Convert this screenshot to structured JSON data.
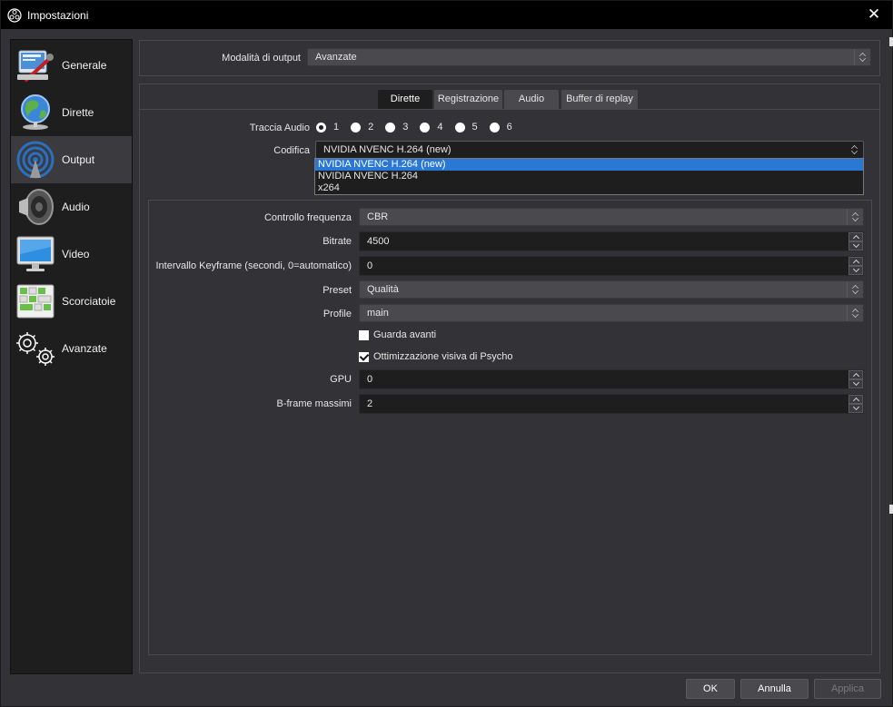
{
  "window": {
    "title": "Impostazioni",
    "close_glyph": "✕"
  },
  "sidebar": {
    "items": [
      {
        "label": "Generale",
        "icon": "settings-wrench-icon"
      },
      {
        "label": "Dirette",
        "icon": "globe-icon"
      },
      {
        "label": "Output",
        "icon": "broadcast-icon"
      },
      {
        "label": "Audio",
        "icon": "speaker-icon"
      },
      {
        "label": "Video",
        "icon": "monitor-icon"
      },
      {
        "label": "Scorciatoie",
        "icon": "keyboard-icon"
      },
      {
        "label": "Avanzate",
        "icon": "gears-icon"
      }
    ],
    "active": "Output"
  },
  "output_mode": {
    "label": "Modalità di output",
    "value": "Avanzate"
  },
  "tabs": [
    {
      "label": "Dirette",
      "active": true
    },
    {
      "label": "Registrazione",
      "active": false
    },
    {
      "label": "Audio",
      "active": false
    },
    {
      "label": "Buffer di replay",
      "active": false
    }
  ],
  "audio_track": {
    "label": "Traccia Audio",
    "options": [
      "1",
      "2",
      "3",
      "4",
      "5",
      "6"
    ],
    "selected": "1"
  },
  "encoder": {
    "label": "Codifica",
    "value": "NVIDIA NVENC H.264 (new)",
    "options": [
      "NVIDIA NVENC H.264 (new)",
      "NVIDIA NVENC H.264",
      "x264"
    ],
    "highlighted": "NVIDIA NVENC H.264 (new)"
  },
  "settings": {
    "rate_control": {
      "label": "Controllo frequenza",
      "value": "CBR"
    },
    "bitrate": {
      "label": "Bitrate",
      "value": "4500"
    },
    "keyframe": {
      "label": "Intervallo Keyframe (secondi, 0=automatico)",
      "value": "0"
    },
    "preset": {
      "label": "Preset",
      "value": "Qualità"
    },
    "profile": {
      "label": "Profile",
      "value": "main"
    },
    "lookahead": {
      "label": "Guarda avanti",
      "checked": false
    },
    "psycho": {
      "label": "Ottimizzazione visiva di Psycho",
      "checked": true
    },
    "gpu": {
      "label": "GPU",
      "value": "0"
    },
    "bframes": {
      "label": "B-frame massimi",
      "value": "2"
    }
  },
  "buttons": {
    "ok": "OK",
    "cancel": "Annulla",
    "apply": "Applica"
  }
}
